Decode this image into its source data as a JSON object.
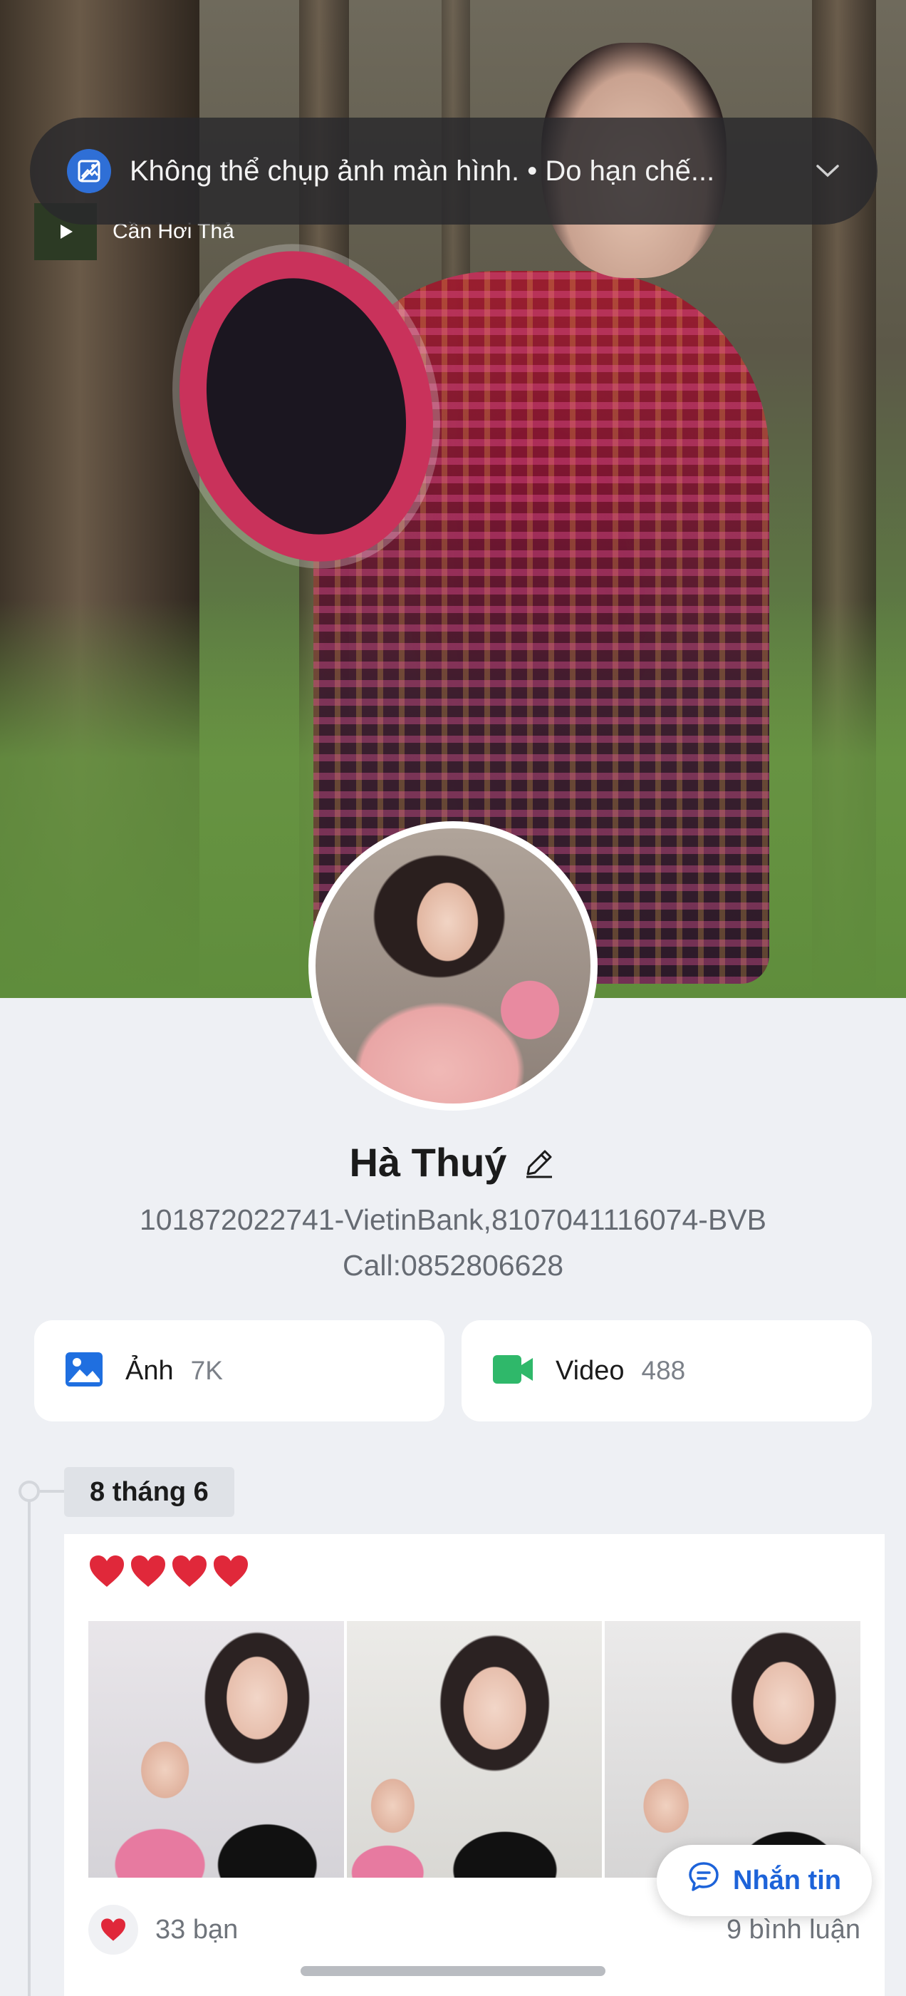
{
  "notification": {
    "text": "Không thể chụp ảnh màn hình. • Do hạn chế...",
    "icon": "screenshot-blocked-icon",
    "expand_icon": "chevron-down-icon"
  },
  "mini_player": {
    "title": "Cần Hơi Thả"
  },
  "profile": {
    "name": "Hà Thuý",
    "bio_line1": "101872022741-VietinBank,8107041116074-BVB",
    "bio_line2": "Call:0852806628"
  },
  "media": [
    {
      "label": "Ảnh",
      "count": "7K",
      "icon": "image-icon",
      "color": "#1f6fe0"
    },
    {
      "label": "Video",
      "count": "488",
      "icon": "video-camera-icon",
      "color": "#2fb86a"
    }
  ],
  "timeline": {
    "date": "8 tháng 6"
  },
  "post": {
    "caption": "❤️❤️❤️❤️",
    "reactions_label": "33 bạn",
    "comments_label": "9 bình luận"
  },
  "actions": {
    "message_label": "Nhắn tin"
  },
  "colors": {
    "accent": "#1d63d9",
    "background": "#eef0f4"
  }
}
